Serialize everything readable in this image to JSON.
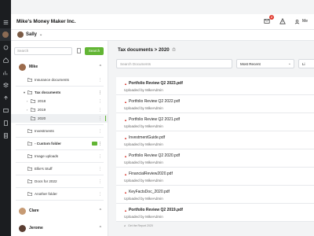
{
  "app": {
    "title": "Mike's Money Maker Inc."
  },
  "header": {
    "notif_count": "2",
    "user_label": "Me"
  },
  "account": {
    "name": "Sally"
  },
  "search": {
    "placeholder": "Search",
    "button": "Search"
  },
  "tree": {
    "user1": "Mike",
    "items": [
      {
        "label": "Insurance documents",
        "level": 0
      },
      {
        "label": "Tax documents",
        "level": 0,
        "bold": true,
        "toggle": "▾"
      },
      {
        "label": "2018",
        "level": 1,
        "toggle": "›"
      },
      {
        "label": "2019",
        "level": 1,
        "toggle": "›"
      },
      {
        "label": "2020",
        "level": 1,
        "active": true
      },
      {
        "label": "Investments",
        "level": 0
      },
      {
        "label": "- Custom folder",
        "level": 0,
        "bold": true,
        "badge": true
      },
      {
        "label": "Image uploads",
        "level": 0
      },
      {
        "label": "Ellie's Stuff",
        "level": 0
      },
      {
        "label": "Docs for 2022",
        "level": 0
      },
      {
        "label": "Another folder",
        "level": 0
      }
    ],
    "user2": "Clare",
    "user3": "Jerome"
  },
  "content": {
    "breadcrumb": "Tax documents > 2020",
    "search_placeholder": "Search Documents",
    "sort": "Most Recent",
    "view": "Li",
    "docs": [
      {
        "name": "Portfolio Review Q2 2023.pdf",
        "by": "Uploaded by MikeAdmin",
        "bold": true
      },
      {
        "name": "Portfolio Review Q2 2022.pdf",
        "by": "Uploaded by MikeAdmin",
        "bold": false
      },
      {
        "name": "Portfolio Review Q2 2021.pdf",
        "by": "Uploaded by MikeAdmin",
        "bold": false
      },
      {
        "name": "InvestmentGuide.pdf",
        "by": "Uploaded by MikeAdmin",
        "bold": false
      },
      {
        "name": "Portfolio Review Q2 2020.pdf",
        "by": "Uploaded by MikeAdmin",
        "bold": false
      },
      {
        "name": "FinancialReview2020.pdf",
        "by": "Uploaded by MikeAdmin",
        "bold": false
      },
      {
        "name": "KeyFactsDoc_2020.pdf",
        "by": "Uploaded by MikeAdmin",
        "bold": false
      },
      {
        "name": "Portfolio Review Q2 2019.pdf",
        "by": "Uploaded by MikeAdmin",
        "bold": true
      }
    ],
    "footer_note": "Get the Report 2020"
  }
}
